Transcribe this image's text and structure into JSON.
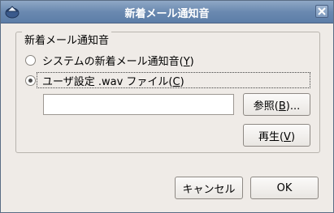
{
  "window": {
    "title": "新着メール通知音"
  },
  "group": {
    "label": "新着メール通知音"
  },
  "options": {
    "system_sound": {
      "label": "システムの新着メール通知音(",
      "mnemonic": "Y",
      "suffix": ")",
      "selected": false
    },
    "user_wav": {
      "label": "ユーザ設定 .wav ファイル(",
      "mnemonic": "C",
      "suffix": ")",
      "selected": true
    }
  },
  "file_input": {
    "value": ""
  },
  "buttons": {
    "browse": {
      "label": "参照(",
      "mnemonic": "B",
      "suffix": ")..."
    },
    "play": {
      "label": "再生(",
      "mnemonic": "V",
      "suffix": ")"
    },
    "cancel": {
      "label": "キャンセル"
    },
    "ok": {
      "label": "OK"
    }
  },
  "colors": {
    "titlebar": "#6a89b0",
    "window_bg": "#efebe7"
  },
  "icons": {
    "app": "mail-app-icon",
    "close": "close-icon"
  }
}
